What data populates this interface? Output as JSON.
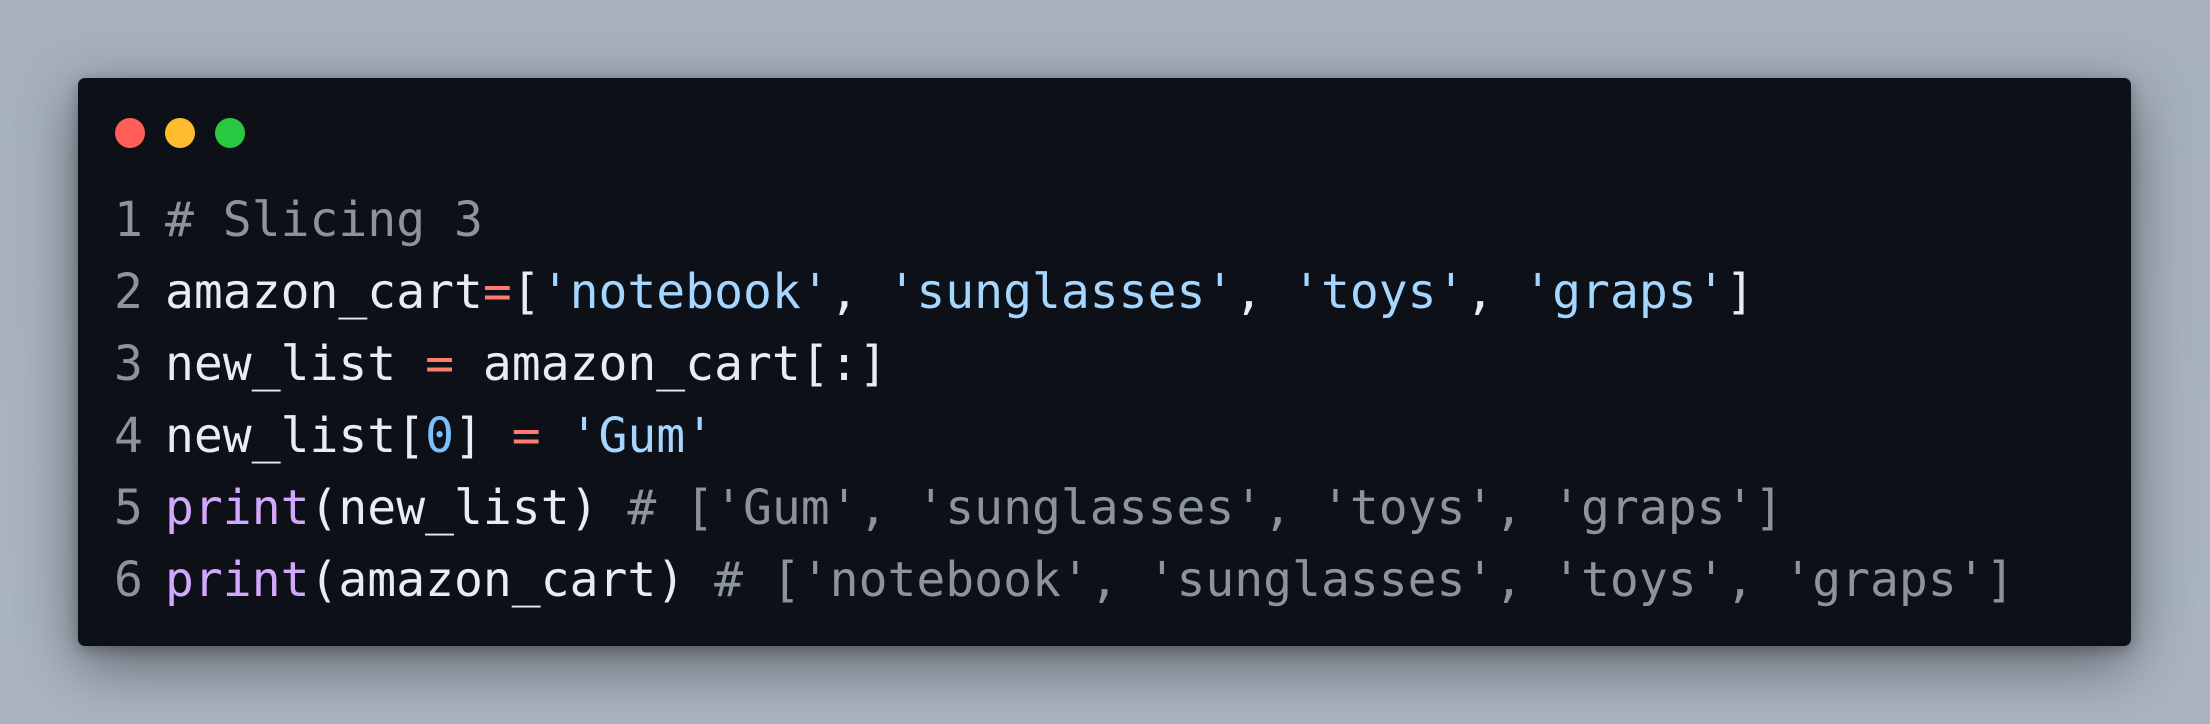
{
  "window": {
    "controls": [
      {
        "name": "close",
        "color": "#ff5f57"
      },
      {
        "name": "minimize",
        "color": "#febc2e"
      },
      {
        "name": "maximize",
        "color": "#28c840"
      }
    ]
  },
  "code": {
    "lines": [
      {
        "number": "1",
        "tokens": [
          {
            "type": "comment",
            "text": "# Slicing 3"
          }
        ]
      },
      {
        "number": "2",
        "tokens": [
          {
            "type": "plain",
            "text": "amazon_cart"
          },
          {
            "type": "op",
            "text": "="
          },
          {
            "type": "plain",
            "text": "["
          },
          {
            "type": "string",
            "text": "'notebook'"
          },
          {
            "type": "plain",
            "text": ", "
          },
          {
            "type": "string",
            "text": "'sunglasses'"
          },
          {
            "type": "plain",
            "text": ", "
          },
          {
            "type": "string",
            "text": "'toys'"
          },
          {
            "type": "plain",
            "text": ", "
          },
          {
            "type": "string",
            "text": "'graps'"
          },
          {
            "type": "plain",
            "text": "]"
          }
        ]
      },
      {
        "number": "3",
        "tokens": [
          {
            "type": "plain",
            "text": "new_list "
          },
          {
            "type": "op",
            "text": "="
          },
          {
            "type": "plain",
            "text": " amazon_cart[:]"
          }
        ]
      },
      {
        "number": "4",
        "tokens": [
          {
            "type": "plain",
            "text": "new_list["
          },
          {
            "type": "num",
            "text": "0"
          },
          {
            "type": "plain",
            "text": "] "
          },
          {
            "type": "op",
            "text": "="
          },
          {
            "type": "plain",
            "text": " "
          },
          {
            "type": "string",
            "text": "'Gum'"
          }
        ]
      },
      {
        "number": "5",
        "tokens": [
          {
            "type": "builtin",
            "text": "print"
          },
          {
            "type": "plain",
            "text": "(new_list) "
          },
          {
            "type": "comment",
            "text": "# ['Gum', 'sunglasses', 'toys', 'graps']"
          }
        ]
      },
      {
        "number": "6",
        "tokens": [
          {
            "type": "builtin",
            "text": "print"
          },
          {
            "type": "plain",
            "text": "(amazon_cart) "
          },
          {
            "type": "comment",
            "text": "# ['notebook', 'sunglasses', 'toys', 'graps']"
          }
        ]
      }
    ]
  }
}
